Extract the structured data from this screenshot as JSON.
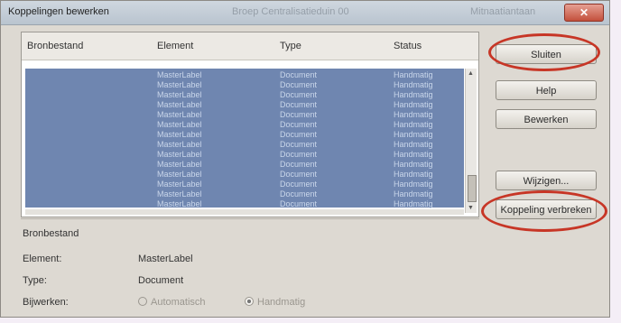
{
  "window": {
    "title": "Koppelingen bewerken",
    "ghost_title": "Broep Centralisatieduin 00",
    "ghost_right": "Mitnaatiantaan",
    "close_symbol": "✕"
  },
  "list": {
    "columns": [
      "Bronbestand",
      "Element",
      "Type",
      "Status"
    ],
    "rows": [
      {
        "element": "MasterLabel",
        "type": "Document",
        "status": "Handmatig"
      },
      {
        "element": "MasterLabel",
        "type": "Document",
        "status": "Handmatig"
      },
      {
        "element": "MasterLabel",
        "type": "Document",
        "status": "Handmatig"
      },
      {
        "element": "MasterLabel",
        "type": "Document",
        "status": "Handmatig"
      },
      {
        "element": "MasterLabel",
        "type": "Document",
        "status": "Handmatig"
      },
      {
        "element": "MasterLabel",
        "type": "Document",
        "status": "Handmatig"
      },
      {
        "element": "MasterLabel",
        "type": "Document",
        "status": "Handmatig"
      },
      {
        "element": "MasterLabel",
        "type": "Document",
        "status": "Handmatig"
      },
      {
        "element": "MasterLabel",
        "type": "Document",
        "status": "Handmatig"
      },
      {
        "element": "MasterLabel",
        "type": "Document",
        "status": "Handmatig"
      },
      {
        "element": "MasterLabel",
        "type": "Document",
        "status": "Handmatig"
      },
      {
        "element": "MasterLabel",
        "type": "Document",
        "status": "Handmatig"
      },
      {
        "element": "MasterLabel",
        "type": "Document",
        "status": "Handmatig"
      },
      {
        "element": "MasterLabel",
        "type": "Document",
        "status": "Handmatig"
      }
    ]
  },
  "buttons": {
    "close": "Sluiten",
    "help": "Help",
    "edit": "Bewerken",
    "change": "Wijzigen...",
    "break_link": "Koppeling verbreken"
  },
  "details": {
    "section_label": "Bronbestand",
    "element_label": "Element:",
    "element_value": "MasterLabel",
    "type_label": "Type:",
    "type_value": "Document",
    "update_label": "Bijwerken:",
    "option_auto": "Automatisch",
    "option_manual": "Handmatig"
  },
  "colors": {
    "selection": "#6f86b0",
    "annotation": "#c73626"
  }
}
